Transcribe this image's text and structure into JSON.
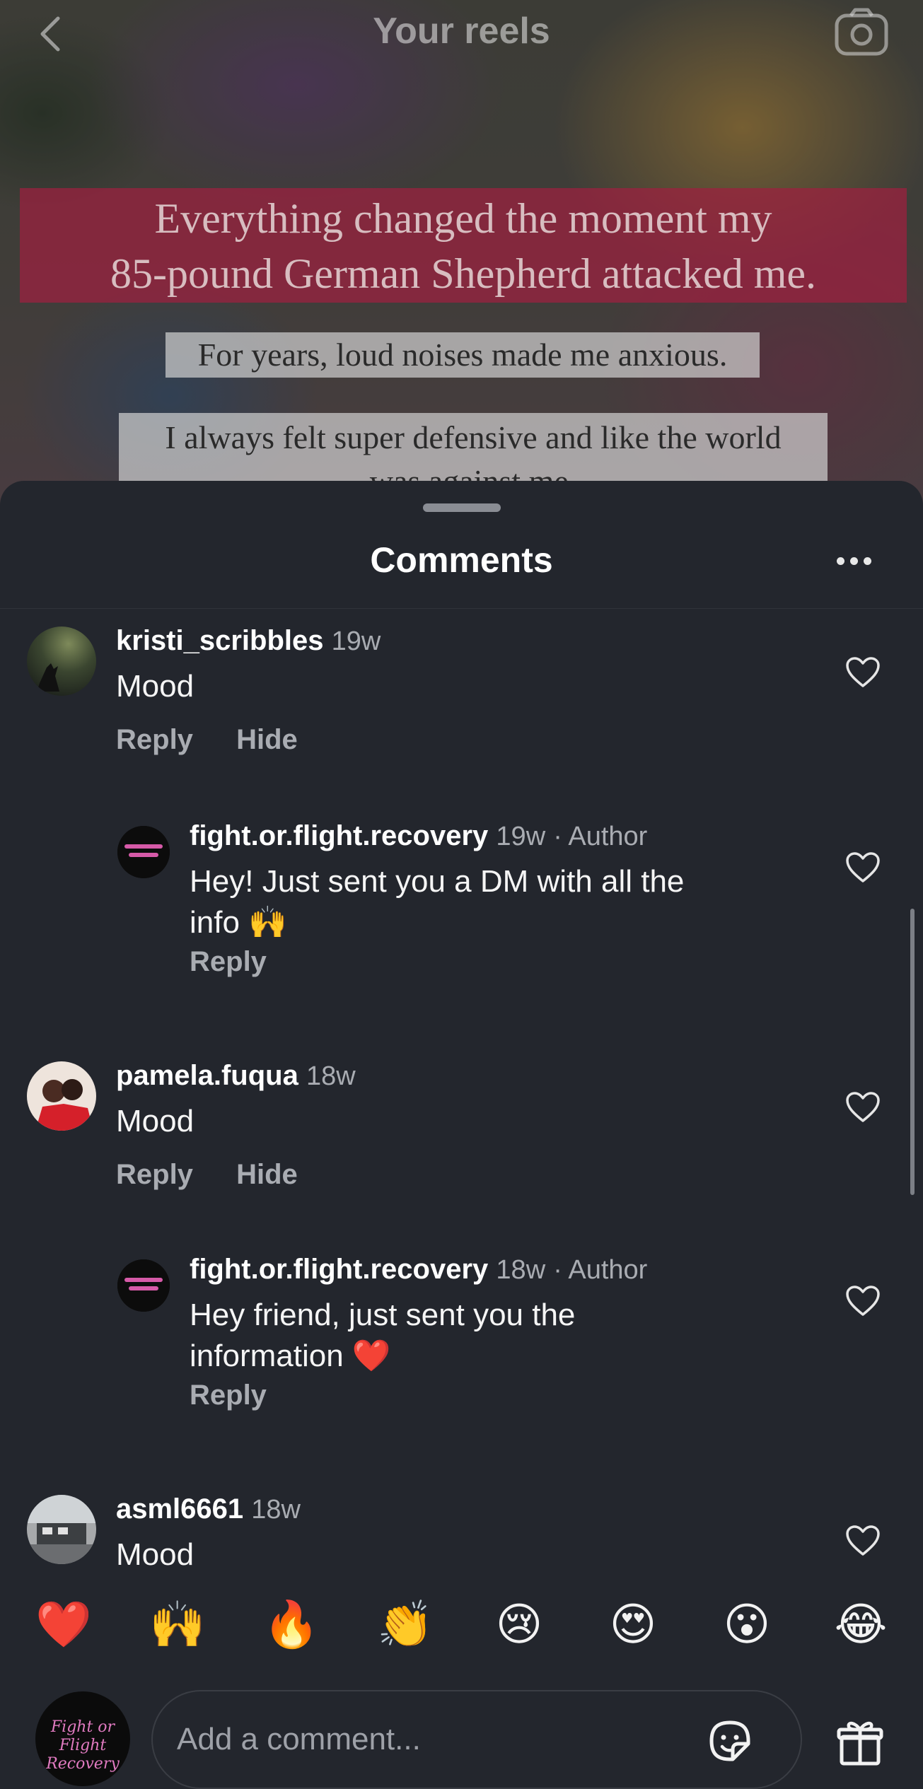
{
  "header": {
    "title": "Your reels",
    "back_icon": "chevron-left-icon",
    "camera_icon": "camera-icon"
  },
  "reel": {
    "caption_1_line_1": "Everything changed the moment my",
    "caption_1_line_2": "85-pound German Shepherd attacked me.",
    "caption_2": "For years, loud noises made me anxious.",
    "caption_3_line_1": "I always felt super defensive and like the world",
    "caption_3_line_2": "was against me."
  },
  "sheet": {
    "title": "Comments",
    "more_icon": "more-horizontal-icon"
  },
  "comments": [
    {
      "username": "kristi_scribbles",
      "time": "19w",
      "text": "Mood",
      "reply_label": "Reply",
      "hide_label": "Hide"
    },
    {
      "username": "fight.or.flight.recovery",
      "time": "19w",
      "author_tag": "· Author",
      "text_line_1": "Hey! Just sent you a DM with all the",
      "text_line_2": "info 🙌",
      "reply_label": "Reply"
    },
    {
      "username": "pamela.fuqua",
      "time": "18w",
      "text": "Mood",
      "reply_label": "Reply",
      "hide_label": "Hide"
    },
    {
      "username": "fight.or.flight.recovery",
      "time": "18w",
      "author_tag": "· Author",
      "text_line_1": "Hey friend, just sent you the",
      "text_line_2": "information ❤️",
      "reply_label": "Reply"
    },
    {
      "username": "asml6661",
      "time": "18w",
      "text": "Mood"
    }
  ],
  "emoji_bar": [
    "❤️",
    "🙌",
    "🔥",
    "👏",
    "😢",
    "😍",
    "😮",
    "😂"
  ],
  "composer": {
    "placeholder": "Add a comment...",
    "avatar_text_1": "Fight or Flight",
    "avatar_text_2": "Recovery",
    "sticker_icon": "sticker-icon",
    "gift_icon": "gift-icon"
  },
  "colors": {
    "sheet_bg": "#23262d",
    "muted_text": "#a9acb2",
    "caption_red": "#9e2040",
    "heart_emoji": "#e0212f"
  }
}
